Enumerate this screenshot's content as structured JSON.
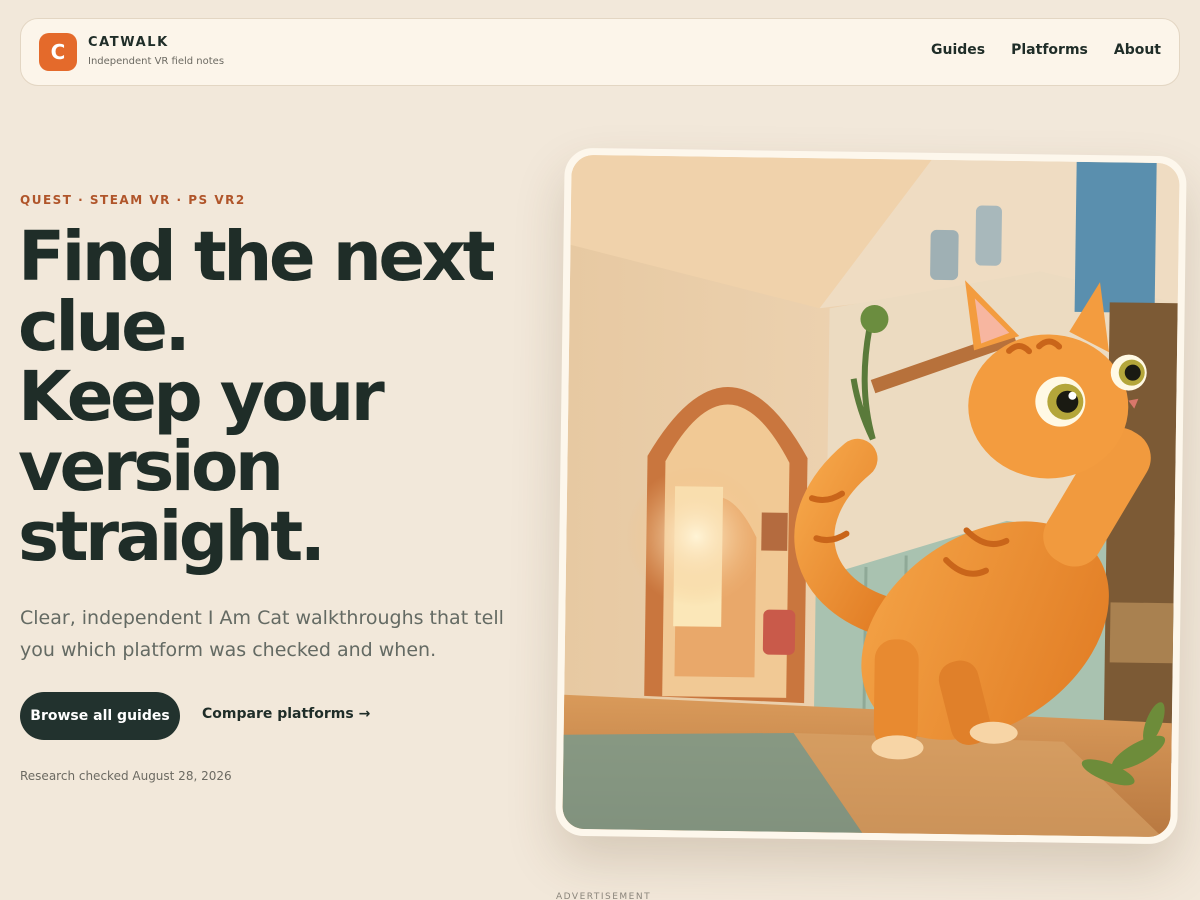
{
  "header": {
    "logo_letter": "C",
    "brand_name": "CATWALK",
    "tagline": "Independent VR field notes",
    "nav": [
      "Guides",
      "Platforms",
      "About"
    ]
  },
  "hero": {
    "eyebrow": "QUEST · STEAM VR · PS VR2",
    "headline_lines": [
      "Find the next",
      "clue.",
      "Keep your",
      "version",
      "straight."
    ],
    "subtext": "Clear, independent I Am Cat walkthroughs that tell you which platform was checked and when.",
    "primary_button": "Browse all guides",
    "secondary_link": "Compare platforms →",
    "research_note": "Research checked August 28, 2026"
  },
  "footer": {
    "ad_label": "ADVERTISEMENT"
  },
  "colors": {
    "background": "#f2e8da",
    "accent": "#e46a2b",
    "ink": "#1f2d28",
    "eyebrow": "#b0552a"
  }
}
